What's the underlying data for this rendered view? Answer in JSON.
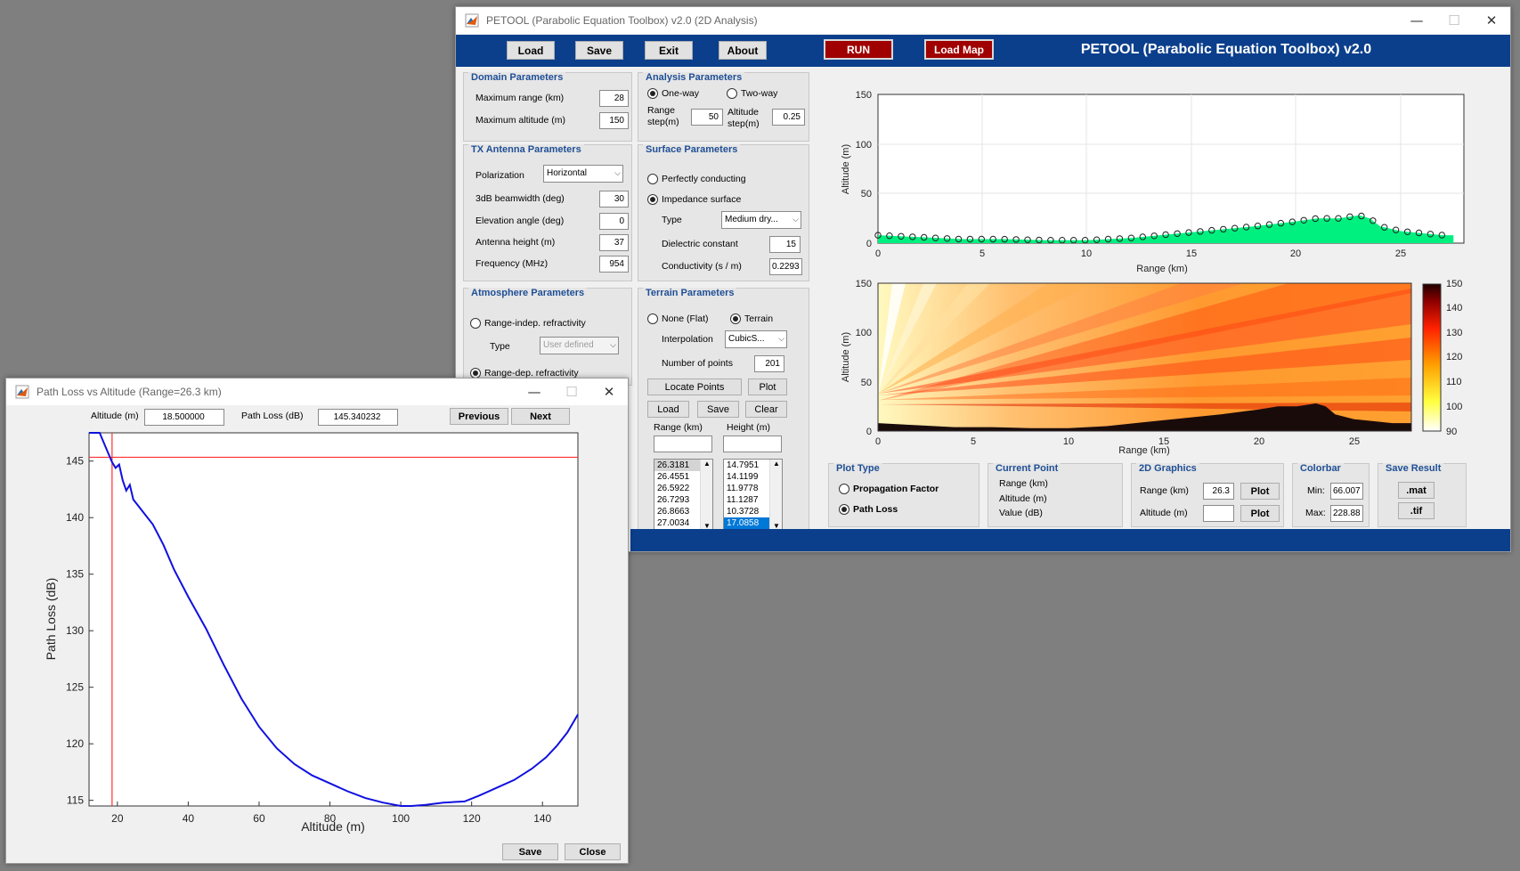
{
  "main_window": {
    "title": "PETOOL (Parabolic Equation Toolbox) v2.0 (2D Analysis)",
    "controls": {
      "minimize": "—",
      "maximize": "☐",
      "close": "✕"
    }
  },
  "toolbar": {
    "load": "Load",
    "save": "Save",
    "exit": "Exit",
    "about": "About",
    "run": "RUN",
    "load_map": "Load Map",
    "heading": "PETOOL (Parabolic Equation Toolbox) v2.0"
  },
  "domain_params": {
    "title": "Domain Parameters",
    "max_range_label": "Maximum range (km)",
    "max_range": "28",
    "max_alt_label": "Maximum altitude (m)",
    "max_alt": "150"
  },
  "analysis_params": {
    "title": "Analysis Parameters",
    "one_way": "One-way",
    "two_way": "Two-way",
    "range_step_label": "Range",
    "range_step_label2": "step(m)",
    "range_step": "50",
    "alt_step_label": "Altitude",
    "alt_step_label2": "step(m)",
    "alt_step": "0.25"
  },
  "tx_params": {
    "title": "TX Antenna Parameters",
    "polarization_label": "Polarization",
    "polarization": "Horizontal",
    "beamwidth_label": "3dB beamwidth (deg)",
    "beamwidth": "30",
    "elevation_label": "Elevation angle (deg)",
    "elevation": "0",
    "height_label": "Antenna height (m)",
    "height": "37",
    "frequency_label": "Frequency (MHz)",
    "frequency": "954"
  },
  "surface_params": {
    "title": "Surface Parameters",
    "perfect": "Perfectly conducting",
    "impedance": "Impedance surface",
    "type_label": "Type",
    "type": "Medium dry...",
    "dielectric_label": "Dielectric constant",
    "dielectric": "15",
    "conductivity_label": "Conductivity (s / m)",
    "conductivity": "0.2293"
  },
  "atmosphere_params": {
    "title": "Atmosphere Parameters",
    "range_indep": "Range-indep. refractivity",
    "type_label": "Type",
    "type": "User defined",
    "range_dep": "Range-dep. refractivity"
  },
  "terrain_params": {
    "title": "Terrain Parameters",
    "none": "None (Flat)",
    "terrain": "Terrain",
    "interp_label": "Interpolation",
    "interp": "CubicS...",
    "npoints_label": "Number of points",
    "npoints": "201",
    "locate": "Locate Points",
    "plot": "Plot",
    "load": "Load",
    "save": "Save",
    "clear": "Clear",
    "range_header": "Range (km)",
    "height_header": "Height (m)",
    "range_list": [
      "26.3181",
      "26.4551",
      "26.5922",
      "26.7293",
      "26.8663",
      "27.0034"
    ],
    "height_list": [
      "14.7951",
      "14.1199",
      "11.9778",
      "11.1287",
      "10.3728",
      "17.0858"
    ]
  },
  "plot_type": {
    "title": "Plot Type",
    "pf": "Propagation Factor",
    "pl": "Path Loss"
  },
  "current_point": {
    "title": "Current Point",
    "range": "Range (km)",
    "altitude": "Altitude (m)",
    "value": "Value (dB)"
  },
  "graphics_2d": {
    "title": "2D Graphics",
    "range_label": "Range (km)",
    "range": "26.3",
    "alt_label": "Altitude (m)",
    "alt": "",
    "plot": "Plot"
  },
  "colorbar_grp": {
    "title": "Colorbar",
    "min_label": "Min:",
    "min": "66.007",
    "max_label": "Max:",
    "max": "228.88"
  },
  "save_result": {
    "title": "Save Result",
    "mat": ".mat",
    "tif": ".tif"
  },
  "terrain_plot": {
    "ylabel": "Altitude (m)",
    "xlabel": "Range (km)",
    "xticks": [
      "0",
      "5",
      "10",
      "15",
      "20",
      "25"
    ],
    "yticks": [
      "0",
      "50",
      "100",
      "150"
    ]
  },
  "field_plot": {
    "ylabel": "Altitude (m)",
    "xlabel": "Range (km)",
    "xticks": [
      "0",
      "5",
      "10",
      "15",
      "20",
      "25"
    ],
    "yticks": [
      "0",
      "50",
      "100",
      "150"
    ],
    "colorbar_ticks": [
      "90",
      "100",
      "110",
      "120",
      "130",
      "140",
      "150"
    ]
  },
  "colors": {
    "accent": "#0b3f8c",
    "run": "#a00000",
    "terrain_fill": "#00f07f",
    "curve": "#1010e0",
    "marker": "#ff3030"
  },
  "popup": {
    "title": "Path Loss vs Altitude (Range=26.3 km)",
    "alt_label": "Altitude (m)",
    "alt_value": "18.500000",
    "pl_label": "Path Loss (dB)",
    "pl_value": "145.340232",
    "previous": "Previous",
    "next": "Next",
    "save": "Save",
    "close": "Close"
  },
  "chart_data": {
    "type": "line",
    "title": "",
    "xlabel": "Altitude (m)",
    "ylabel": "Path Loss (dB)",
    "xlim": [
      12,
      150
    ],
    "ylim": [
      114.5,
      147.5
    ],
    "xticks": [
      20,
      40,
      60,
      80,
      100,
      120,
      140
    ],
    "yticks": [
      115,
      120,
      125,
      130,
      135,
      140,
      145
    ],
    "grid": false,
    "marker": {
      "x": 18.5,
      "y": 145.34
    },
    "series": [
      {
        "x": [
          12,
          15,
          17,
          18.5,
          19.5,
          20.5,
          21.5,
          22.5,
          23.5,
          24.5,
          26,
          27,
          28,
          30,
          33,
          36,
          40,
          45,
          50,
          55,
          60,
          65,
          70,
          75,
          80,
          85,
          90,
          95,
          100,
          103,
          107,
          112,
          118,
          122,
          127,
          132,
          137,
          141,
          144,
          147,
          150
        ],
        "values": [
          152,
          148,
          146,
          144.9,
          144.4,
          144.7,
          143.3,
          142.4,
          142.9,
          141.6,
          141.0,
          140.6,
          140.2,
          139.4,
          137.6,
          135.4,
          133.0,
          130.2,
          127.0,
          124.0,
          121.5,
          119.6,
          118.2,
          117.2,
          116.5,
          115.8,
          115.2,
          114.8,
          114.5,
          114.45,
          114.6,
          114.8,
          114.9,
          115.4,
          116.1,
          116.8,
          117.8,
          118.8,
          119.8,
          121.0,
          122.6
        ]
      }
    ]
  }
}
